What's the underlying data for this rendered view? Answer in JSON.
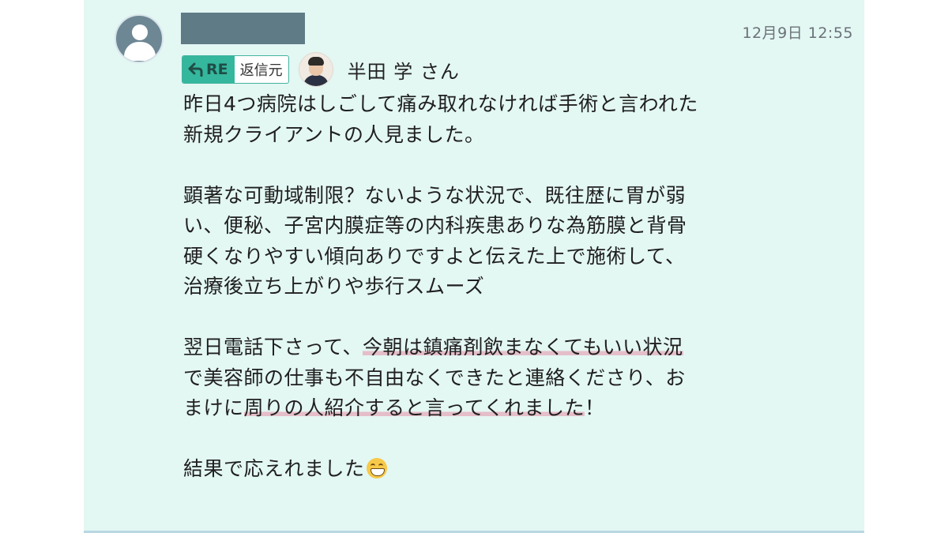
{
  "post": {
    "timestamp": "12月9日 12:55"
  },
  "reply": {
    "badge_re": "RE",
    "badge_label": "返信元",
    "replier_name": "半田 学 さん"
  },
  "message": {
    "p1_line1": "昨日4つ病院はしごして痛み取れなければ手術と言われた",
    "p1_line2": "新規クライアントの人見ました。",
    "p2_line1": "顕著な可動域制限？ないような状況で、既往歴に胃が弱",
    "p2_line2": "い、便秘、子宮内膜症等の内科疾患ありな為筋膜と背骨",
    "p2_line3": "硬くなりやすい傾向ありですよと伝えた上で施術して、",
    "p2_line4": "治療後立ち上がりや歩行スムーズ",
    "p3_line1_pre": "翌日電話下さって、",
    "p3_line1_hl": "今朝は鎮痛剤飲まなくてもいい状況",
    "p3_line2": "で美容師の仕事も不自由なくできたと連絡くださり、お",
    "p3_line3_pre": "まけに",
    "p3_line3_hl": "周りの人紹介すると言ってくれました",
    "p3_line3_post": "！",
    "p4_line1": "結果で応えれました"
  },
  "icons": {
    "avatar": "default-user-icon",
    "reply_arrow": "reply-arrow-icon",
    "emoji": "grinning-face-emoji"
  },
  "colors": {
    "panel_bg": "#e3f7f3",
    "re_badge": "#34b79d",
    "highlight": "#e678a0"
  }
}
